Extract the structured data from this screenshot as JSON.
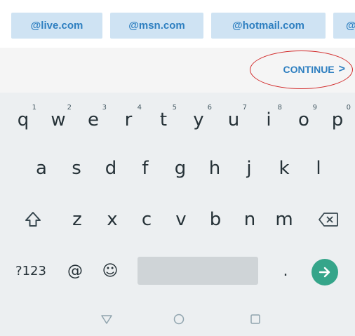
{
  "suggestions": {
    "items": [
      "@live.com",
      "@msn.com",
      "@hotmail.com",
      "@"
    ]
  },
  "action": {
    "continue_label": "CONTINUE",
    "continue_chevron": ">"
  },
  "keyboard": {
    "row1": [
      {
        "key": "q",
        "hint": "1"
      },
      {
        "key": "w",
        "hint": "2"
      },
      {
        "key": "e",
        "hint": "3"
      },
      {
        "key": "r",
        "hint": "4"
      },
      {
        "key": "t",
        "hint": "5"
      },
      {
        "key": "y",
        "hint": "6"
      },
      {
        "key": "u",
        "hint": "7"
      },
      {
        "key": "i",
        "hint": "8"
      },
      {
        "key": "o",
        "hint": "9"
      },
      {
        "key": "p",
        "hint": "0"
      }
    ],
    "row2": [
      "a",
      "s",
      "d",
      "f",
      "g",
      "h",
      "j",
      "k",
      "l"
    ],
    "row3": [
      "z",
      "x",
      "c",
      "v",
      "b",
      "n",
      "m"
    ],
    "symbols_label": "?123",
    "at_label": "@",
    "emoji_label": "☺",
    "period_label": ".",
    "shift_icon": "shift-arrow-icon",
    "backspace_icon": "backspace-icon",
    "enter_icon": "arrow-right-icon"
  },
  "colors": {
    "accent": "#2e7fc0",
    "chip_bg": "#cfe3f3",
    "enter_bg": "#35a58a",
    "annotation": "#d22a2a",
    "keyboard_bg": "#eceff1"
  }
}
